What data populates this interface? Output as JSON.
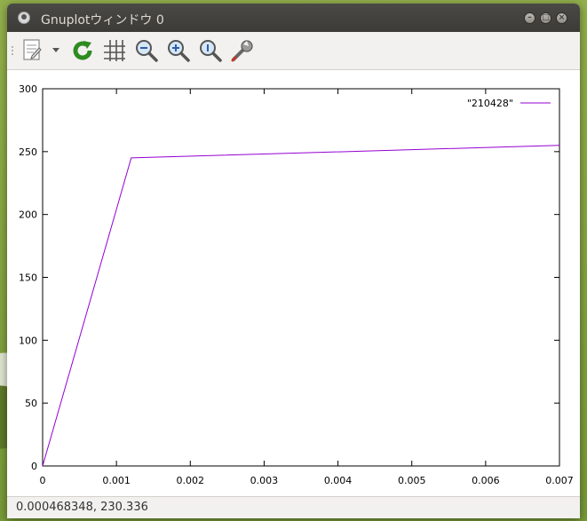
{
  "window": {
    "title": "Gnuplotウィンドウ 0",
    "controls": {
      "minimize": "–",
      "maximize": "□",
      "close": "×"
    }
  },
  "toolbar": {
    "buttons": [
      {
        "icon": "copy-clipboard-icon"
      },
      {
        "icon": "dropdown-arrow-icon"
      },
      {
        "icon": "replot-icon"
      },
      {
        "icon": "grid-icon"
      },
      {
        "icon": "zoom-out-icon"
      },
      {
        "icon": "zoom-in-icon"
      },
      {
        "icon": "zoom-reset-icon"
      },
      {
        "icon": "settings-wrench-icon"
      }
    ]
  },
  "status": {
    "coordinates": "0.000468348,  230.336"
  },
  "chart_data": {
    "type": "line",
    "series": [
      {
        "name": "\"210428\"",
        "color": "#9400d3",
        "x": [
          0,
          0.0012,
          0.007
        ],
        "y": [
          0,
          245,
          255
        ]
      }
    ],
    "xlim": [
      0,
      0.007
    ],
    "ylim": [
      0,
      300
    ],
    "xticks": [
      "0",
      "0.001",
      "0.002",
      "0.003",
      "0.004",
      "0.005",
      "0.006",
      "0.007"
    ],
    "yticks": [
      "0",
      "50",
      "100",
      "150",
      "200",
      "250",
      "300"
    ],
    "grid": false,
    "legend": "top-right"
  }
}
